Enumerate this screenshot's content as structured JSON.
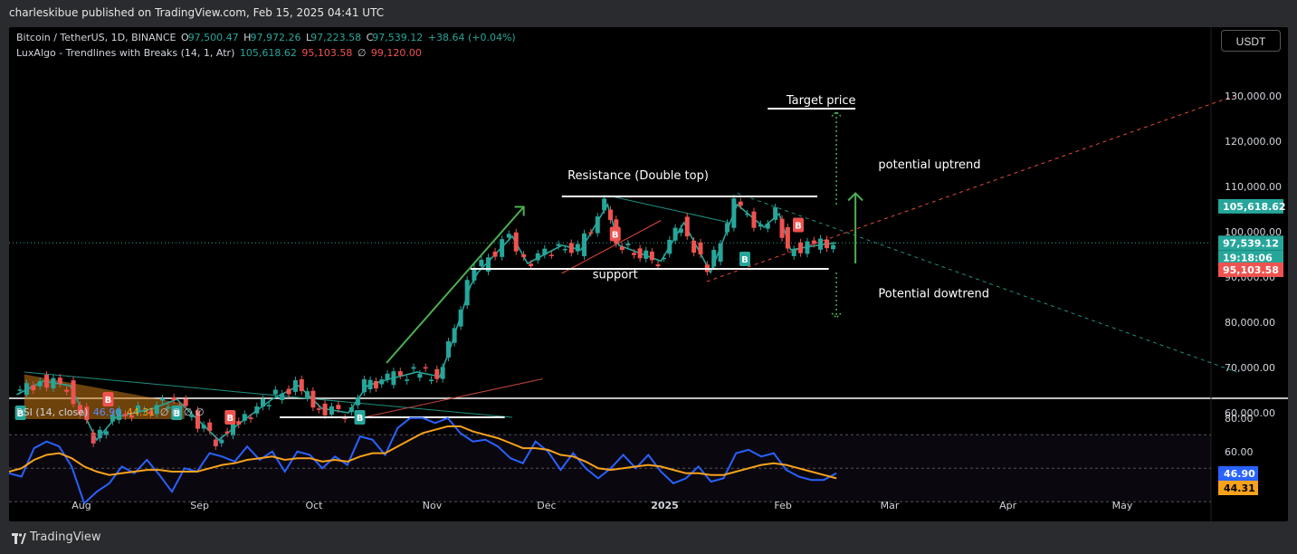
{
  "header": {
    "published": "charleskibue published on TradingView.com, Feb 15, 2025 04:41 UTC"
  },
  "legend": {
    "symbol": "Bitcoin / TetherUS, 1D, BINANCE",
    "open_label": "O",
    "open": "97,500.47",
    "high_label": "H",
    "high": "97,972.26",
    "low_label": "L",
    "low": "97,223.58",
    "close_label": "C",
    "close": "97,539.12",
    "change": "+38.64 (+0.04%)",
    "indicator": "LuxAlgo - Trendlines with Breaks (14, 1, Atr)",
    "ind_v1": "105,618.62",
    "ind_v2": "95,103.58",
    "ind_sym": "∅",
    "ind_v3": "99,120.00",
    "rsi_label": "RSI (14, close)",
    "rsi_v1": "46.90",
    "rsi_v2": "44.31",
    "rsi_rest": "∅ ∅ ∅ ∅"
  },
  "unit_button": "USDT",
  "footer": {
    "brand": "TradingView"
  },
  "colors": {
    "up": "#26a69a",
    "down": "#ef5350",
    "rsi": "#2962ff",
    "rsi_ma": "#f7a21b",
    "arrow": "#4caf50",
    "resist_line": "#ffffff",
    "teal_line": "#1f8f80",
    "red_line": "#e5483f"
  },
  "chart_data": {
    "type": "candlestick",
    "title": "Bitcoin / TetherUS, 1D, BINANCE",
    "ylim": [
      57000,
      133000
    ],
    "y_ticks": [
      "130,000.00",
      "120,000.00",
      "110,000.00",
      "100,000.00",
      "90,000.00",
      "80,000.00",
      "70,000.00",
      "60,000.00"
    ],
    "y_tick_values": [
      130000,
      120000,
      110000,
      100000,
      90000,
      80000,
      70000,
      60000
    ],
    "x_ticks": [
      "Aug",
      "Sep",
      "Oct",
      "Nov",
      "Dec",
      "2025",
      "Feb",
      "Mar",
      "Apr",
      "May"
    ],
    "x_tick_dates": [
      "2024-08-01",
      "2024-09-01",
      "2024-10-01",
      "2024-11-01",
      "2024-12-01",
      "2025-01-01",
      "2025-02-01",
      "2025-03-01",
      "2025-04-01",
      "2025-05-01"
    ],
    "close_path": [
      [
        "2024-07-15",
        64000
      ],
      [
        "2024-07-22",
        67000
      ],
      [
        "2024-07-29",
        66000
      ],
      [
        "2024-08-05",
        54000
      ],
      [
        "2024-08-10",
        59000
      ],
      [
        "2024-08-20",
        61000
      ],
      [
        "2024-08-26",
        63000
      ],
      [
        "2024-09-06",
        54000
      ],
      [
        "2024-09-12",
        58000
      ],
      [
        "2024-09-20",
        63000
      ],
      [
        "2024-09-27",
        66000
      ],
      [
        "2024-10-03",
        61000
      ],
      [
        "2024-10-10",
        60000
      ],
      [
        "2024-10-15",
        66000
      ],
      [
        "2024-10-21",
        67500
      ],
      [
        "2024-10-28",
        69000
      ],
      [
        "2024-11-03",
        68000
      ],
      [
        "2024-11-06",
        75000
      ],
      [
        "2024-11-11",
        88000
      ],
      [
        "2024-11-13",
        91000
      ],
      [
        "2024-11-22",
        99000
      ],
      [
        "2024-11-26",
        93000
      ],
      [
        "2024-12-05",
        97000
      ],
      [
        "2024-12-10",
        96000
      ],
      [
        "2024-12-17",
        106000
      ],
      [
        "2024-12-20",
        97000
      ],
      [
        "2024-12-31",
        93500
      ],
      [
        "2025-01-06",
        102000
      ],
      [
        "2025-01-13",
        91000
      ],
      [
        "2025-01-20",
        106000
      ],
      [
        "2025-01-27",
        101000
      ],
      [
        "2025-01-31",
        104000
      ],
      [
        "2025-02-03",
        96000
      ],
      [
        "2025-02-10",
        97000
      ],
      [
        "2025-02-15",
        97539
      ]
    ],
    "price_labels": [
      {
        "text": "105,618.62",
        "value": 105618.62,
        "color": "#26a69a"
      },
      {
        "text": "97,539.12",
        "value": 97539.12,
        "color": "#26a69a"
      },
      {
        "text": "19:18:06",
        "value": 94300,
        "color": "#26a69a"
      },
      {
        "text": "95,103.58",
        "value": 91600,
        "color": "#ef5350"
      }
    ],
    "annotations": [
      {
        "text": "Target price",
        "date": "2025-02-11",
        "value": 128200
      },
      {
        "text": "Resistance (Double top)",
        "date": "2024-12-25",
        "value": 111600
      },
      {
        "text": "potential uptrend",
        "date": "2025-02-26",
        "value": 114000
      },
      {
        "text": "support",
        "date": "2024-12-19",
        "value": 89700
      },
      {
        "text": "Potential dowtrend",
        "date": "2025-02-26",
        "value": 85500
      }
    ],
    "levels": [
      {
        "name": "resistance",
        "value": 107800,
        "from": "2024-12-05",
        "to": "2025-02-10"
      },
      {
        "name": "support",
        "value": 91800,
        "from": "2024-11-11",
        "to": "2025-02-13"
      },
      {
        "name": "target",
        "value": 127200,
        "from": "2025-01-28",
        "to": "2025-02-20"
      },
      {
        "name": "oct-support",
        "value": 59000,
        "from": "2024-09-22",
        "to": "2024-11-20"
      }
    ],
    "rsi": {
      "name": "RSI (14, close)",
      "ylim": [
        20,
        82
      ],
      "ticks": [
        "80.00",
        "60.00"
      ],
      "tick_values": [
        80,
        60
      ],
      "current": "46.90",
      "ma_current": "44.31",
      "rsi_values": [
        47,
        45,
        62,
        66,
        63,
        51,
        29,
        36,
        41,
        51,
        47,
        55,
        46,
        36,
        50,
        48,
        59,
        57,
        54,
        63,
        55,
        60,
        48,
        60,
        58,
        50,
        57,
        52,
        69,
        67,
        58,
        74,
        80,
        80,
        77,
        80,
        71,
        66,
        67,
        63,
        56,
        53,
        66,
        60,
        49,
        59,
        50,
        44,
        50,
        58,
        50,
        58,
        48,
        41,
        44,
        51,
        42,
        44,
        59,
        61,
        57,
        59,
        49,
        45,
        43,
        43,
        47
      ],
      "ma_values": [
        48,
        50,
        55,
        58,
        59,
        56,
        51,
        48,
        46,
        47,
        48,
        49,
        49,
        48,
        48,
        48,
        50,
        52,
        53,
        55,
        56,
        57,
        55,
        56,
        56,
        54,
        55,
        54,
        57,
        59,
        59,
        63,
        67,
        71,
        73,
        75,
        75,
        72,
        70,
        68,
        65,
        62,
        62,
        61,
        58,
        57,
        54,
        50,
        49,
        50,
        51,
        52,
        51,
        49,
        47,
        47,
        46,
        46,
        48,
        50,
        52,
        53,
        52,
        50,
        48,
        46,
        44
      ]
    }
  }
}
